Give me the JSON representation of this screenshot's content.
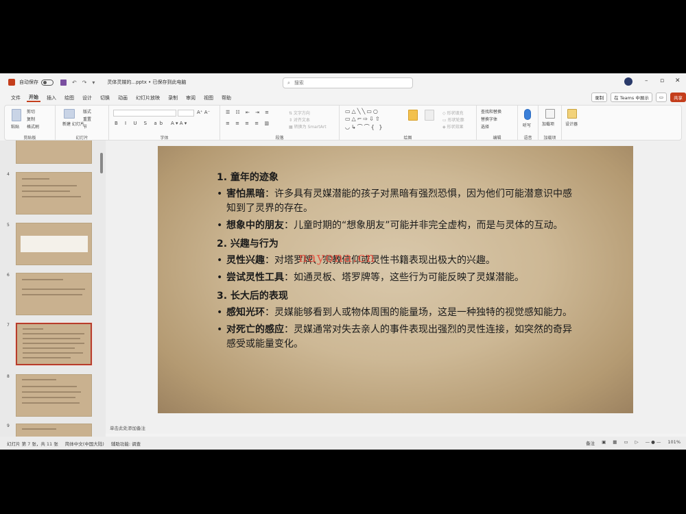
{
  "titlebar": {
    "autosave_label": "自动保存",
    "toggle_state": "关",
    "filename": "灵体灵媒的...pptx • 已保存到此电脑",
    "search_placeholder": "搜索"
  },
  "menu": {
    "tabs": [
      "文件",
      "开始",
      "插入",
      "绘图",
      "设计",
      "切换",
      "动画",
      "幻灯片放映",
      "录制",
      "审阅",
      "视图",
      "帮助"
    ],
    "active_tab": "开始",
    "record_label": "录制",
    "teams_label": "在 Teams 中展示",
    "share_label": "共享"
  },
  "ribbon": {
    "groups": {
      "clipboard": "剪贴板",
      "slides": "幻灯片",
      "font": "字体",
      "paragraph": "段落",
      "drawing": "绘图",
      "editing": "编辑",
      "voice": "语音",
      "addins": "加载项"
    },
    "clipboard_items": [
      "粘贴",
      "剪切",
      "复制",
      "格式刷"
    ],
    "slides_items": [
      "新建\n幻灯片",
      "版式",
      "重置",
      "节"
    ],
    "editing_items": [
      "查找和替换",
      "替换字体",
      "选择"
    ],
    "voice_item": "听写",
    "addins_item": "加载项",
    "designer_item": "设计器"
  },
  "thumbnails": {
    "numbers": [
      "4",
      "5",
      "6",
      "7",
      "8",
      "9"
    ],
    "selected": "7"
  },
  "slide": {
    "sections": [
      {
        "heading": "1. 童年的迹象",
        "bullets": [
          {
            "term": "害怕黑暗",
            "text": "：许多具有灵媒潜能的孩子对黑暗有强烈恐惧，因为他们可能潜意识中感知到了灵界的存在。"
          },
          {
            "term": "想象中的朋友",
            "text": "：儿童时期的“想象朋友”可能并非完全虚构，而是与灵体的互动。"
          }
        ]
      },
      {
        "heading": "2. 兴趣与行为",
        "bullets": [
          {
            "term": "灵性兴趣",
            "text": "：对塔罗牌、宗教信仰或灵性书籍表现出极大的兴趣。"
          },
          {
            "term": "尝试灵性工具",
            "text": "：如通灵板、塔罗牌等，这些行为可能反映了灵媒潜能。"
          }
        ]
      },
      {
        "heading": "3. 长大后的表现",
        "bullets": [
          {
            "term": "感知光环",
            "text": "：灵媒能够看到人或物体周围的能量场，这是一种独特的视觉感知能力。"
          },
          {
            "term": "对死亡的感应",
            "text": "：灵媒通常对失去亲人的事件表现出强烈的灵性连接，如突然的奇异感受或能量变化。"
          }
        ]
      }
    ],
    "watermark": "nayona.cn"
  },
  "notes_placeholder": "单击此处添加备注",
  "status": {
    "slide_info": "幻灯片 第 7 张，共 11 张",
    "language": "简体中文(中国大陆)",
    "accessibility": "辅助功能: 调查",
    "notes_btn": "备注",
    "zoom": "101%"
  },
  "colors": {
    "accent": "#c43e1c",
    "slide_bg": "#cdb895",
    "watermark": "#e64b3b"
  }
}
